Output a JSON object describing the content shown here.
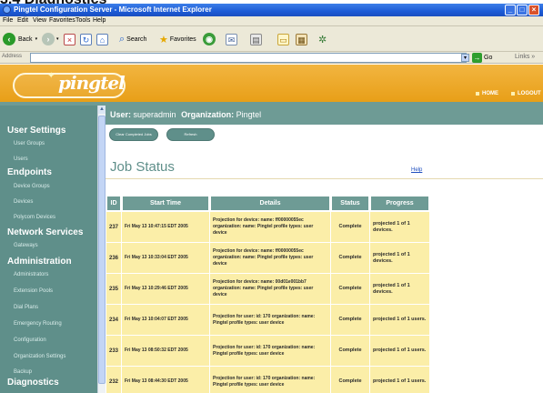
{
  "page_heading": "3.4 Diagnostics",
  "window": {
    "title": "Pingtel Configuration Server - Microsoft Internet Explorer"
  },
  "menu": [
    "File",
    "Edit",
    "View",
    "Favorites",
    "Tools",
    "Help"
  ],
  "toolbar": {
    "back": "Back",
    "search": "Search",
    "favorites": "Favorites"
  },
  "address": {
    "label": "Address",
    "value": "",
    "go": "Go",
    "links": "Links"
  },
  "header": {
    "logo": "pingtel",
    "nav": [
      "HOME",
      "LOGOUT"
    ]
  },
  "sidebar": {
    "sections": [
      {
        "title": "User Settings",
        "items": [
          "User Groups",
          "Users"
        ]
      },
      {
        "title": "Endpoints",
        "items": [
          "Device Groups",
          "Devices",
          "Polycom Devices"
        ]
      },
      {
        "title": "Network Services",
        "items": [
          "Gateways"
        ]
      },
      {
        "title": "Administration",
        "items": [
          "Administrators",
          "Extension Pools",
          "Dial Plans",
          "Emergency Routing",
          "Configuration",
          "Organization Settings",
          "Backup"
        ]
      },
      {
        "title": "Diagnostics",
        "items": []
      }
    ]
  },
  "userbar": {
    "user_label": "User:",
    "user": "superadmin",
    "org_label": "Organization:",
    "org": "Pingtel"
  },
  "buttons": {
    "clear": "Clear Completed Jobs",
    "refresh": "Refresh"
  },
  "page": {
    "title": "Job Status",
    "help": "Help"
  },
  "table": {
    "headers": [
      "ID",
      "Start Time",
      "Details",
      "Status",
      "Progress"
    ],
    "rows": [
      {
        "id": "237",
        "start": "Fri May 13 10:47:15 EDT 2005",
        "details": "Projection for device: name: ff00000055ec organization: name: Pingtel profile types: user device",
        "status": "Complete",
        "progress": "projected 1 of 1 devices."
      },
      {
        "id": "236",
        "start": "Fri May 13 10:33:04 EDT 2005",
        "details": "Projection for device: name: ff00000055ec organization: name: Pingtel profile types: user device",
        "status": "Complete",
        "progress": "projected 1 of 1 devices."
      },
      {
        "id": "235",
        "start": "Fri May 13 10:29:46 EDT 2005",
        "details": "Projection for device: name: 00d01e001bb7 organization: name: Pingtel profile types: user device",
        "status": "Complete",
        "progress": "projected 1 of 1 devices."
      },
      {
        "id": "234",
        "start": "Fri May 13 10:04:07 EDT 2005",
        "details": "Projection for user: id: 170 organization: name: Pingtel profile types: user device",
        "status": "Complete",
        "progress": "projected 1 of 1 users."
      },
      {
        "id": "233",
        "start": "Fri May 13 08:50:32 EDT 2005",
        "details": "Projection for user: id: 170 organization: name: Pingtel profile types: user device",
        "status": "Complete",
        "progress": "projected 1 of 1 users."
      },
      {
        "id": "232",
        "start": "Fri May 13 08:44:30 EDT 2005",
        "details": "Projection for user: id: 170 organization: name: Pingtel profile types: user device",
        "status": "Complete",
        "progress": "projected 1 of 1 users."
      }
    ]
  }
}
